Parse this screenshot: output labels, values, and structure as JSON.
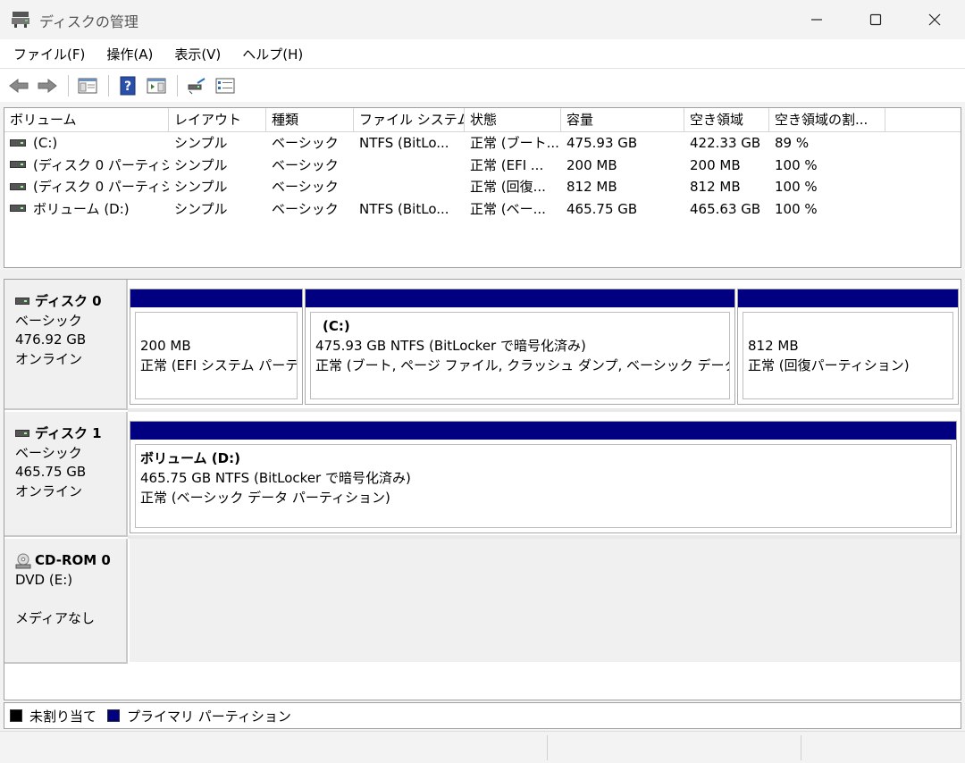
{
  "window": {
    "title": "ディスクの管理"
  },
  "menu": [
    "ファイル(F)",
    "操作(A)",
    "表示(V)",
    "ヘルプ(H)"
  ],
  "toolbar": [
    "back-icon",
    "forward-icon",
    "console-tree-icon",
    "help-icon",
    "action-pane-icon",
    "rescan-icon",
    "properties-icon"
  ],
  "volume_list": {
    "columns": [
      "ボリューム",
      "レイアウト",
      "種類",
      "ファイル システム",
      "状態",
      "容量",
      "空き領域",
      "空き領域の割..."
    ],
    "rows": [
      [
        "(C:)",
        "シンプル",
        "ベーシック",
        "NTFS (BitLo...",
        "正常 (ブート...",
        "475.93 GB",
        "422.33 GB",
        "89 %"
      ],
      [
        "(ディスク 0 パーティシ...",
        "シンプル",
        "ベーシック",
        "",
        "正常 (EFI ...",
        "200 MB",
        "200 MB",
        "100 %"
      ],
      [
        "(ディスク 0 パーティシ...",
        "シンプル",
        "ベーシック",
        "",
        "正常 (回復...",
        "812 MB",
        "812 MB",
        "100 %"
      ],
      [
        "ボリューム (D:)",
        "シンプル",
        "ベーシック",
        "NTFS (BitLo...",
        "正常 (ベー...",
        "465.75 GB",
        "465.63 GB",
        "100 %"
      ]
    ]
  },
  "disks": [
    {
      "name": "ディスク 0",
      "type": "ベーシック",
      "size": "476.92 GB",
      "status": "オンライン",
      "partitions": [
        {
          "name": "",
          "line1": "200 MB",
          "line2": "正常 (EFI システム パーティ"
        },
        {
          "name": "(C:)",
          "line1": "475.93 GB NTFS (BitLocker で暗号化済み)",
          "line2": "正常 (ブート, ページ ファイル, クラッシュ ダンプ, ベーシック データ パーティ"
        },
        {
          "name": "",
          "line1": "812 MB",
          "line2": "正常 (回復パーティション)"
        }
      ]
    },
    {
      "name": "ディスク 1",
      "type": "ベーシック",
      "size": "465.75 GB",
      "status": "オンライン",
      "partitions": [
        {
          "name": "ボリューム  (D:)",
          "line1": "465.75 GB NTFS (BitLocker で暗号化済み)",
          "line2": "正常 (ベーシック データ パーティション)"
        }
      ]
    },
    {
      "name": "CD-ROM 0",
      "type": "DVD (E:)",
      "size": "",
      "status": "メディアなし"
    }
  ],
  "legend": [
    {
      "label": "未割り当て",
      "color": "#000000"
    },
    {
      "label": "プライマリ パーティション",
      "color": "#000080"
    }
  ]
}
